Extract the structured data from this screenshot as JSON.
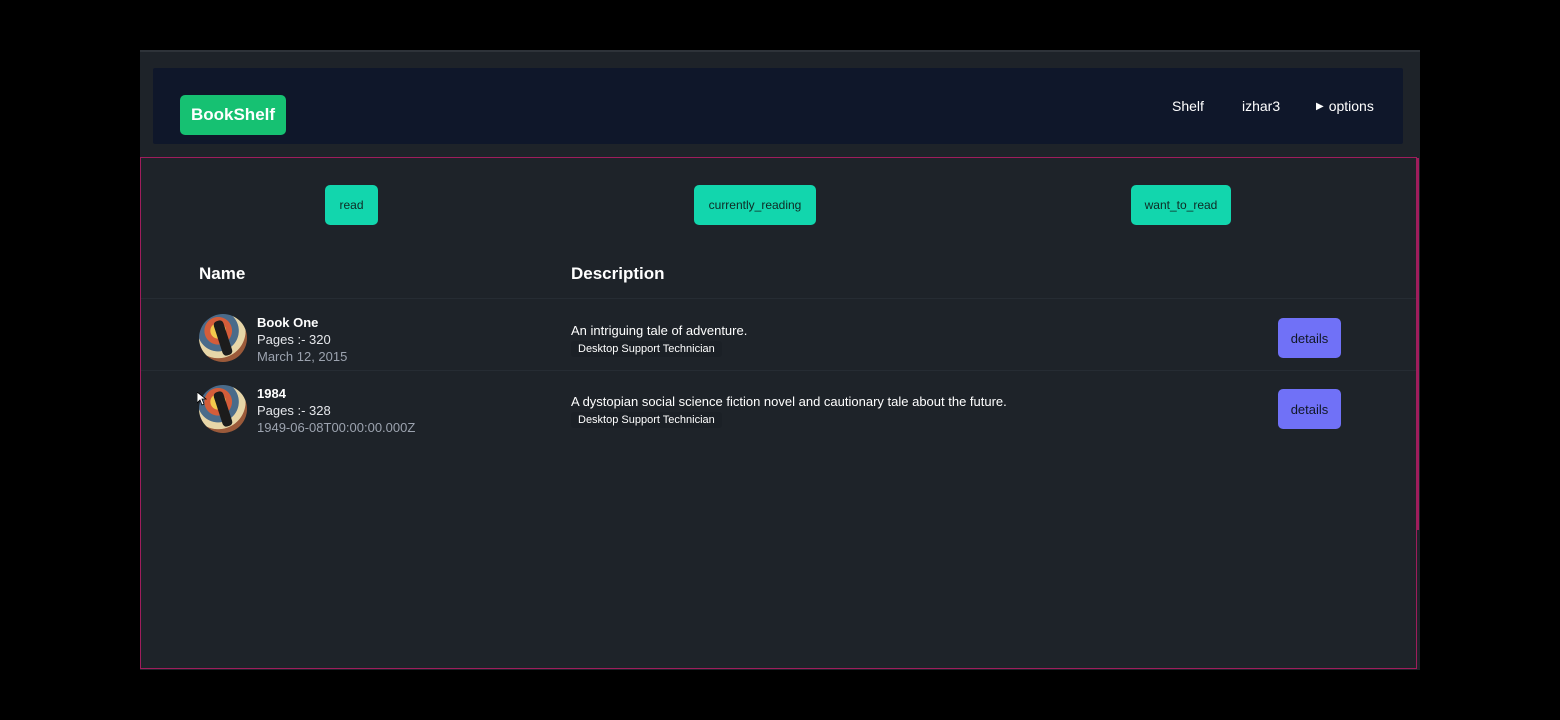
{
  "navbar": {
    "brand": "BookShelf",
    "links": [
      "Shelf",
      "izhar3"
    ],
    "options_label": "options"
  },
  "shelves": {
    "read": "read",
    "currently_reading": "currently_reading",
    "want_to_read": "want_to_read"
  },
  "table": {
    "headers": {
      "name": "Name",
      "description": "Description"
    },
    "rows": [
      {
        "title": "Book One",
        "pages": "Pages :- 320",
        "date": "March 12, 2015",
        "description": "An intriguing tale of adventure.",
        "tag": "Desktop Support Technician",
        "action": "details"
      },
      {
        "title": "1984",
        "pages": "Pages :- 328",
        "date": "1949-06-08T00:00:00.000Z",
        "description": "A dystopian social science fiction novel and cautionary tale about the future.",
        "tag": "Desktop Support Technician",
        "action": "details"
      }
    ]
  },
  "colors": {
    "brand": "#16c172",
    "shelf_button": "#12d6ad",
    "details_button": "#7071f7",
    "navbar_bg": "#0f172a",
    "content_border": "#9f1d5c"
  }
}
